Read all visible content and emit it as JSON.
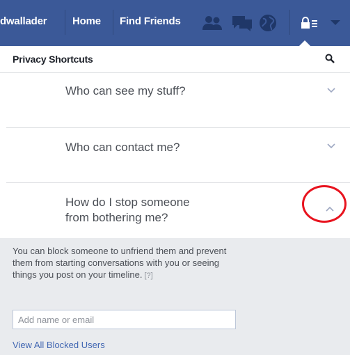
{
  "topbar": {
    "user_name": "dwallader",
    "home_label": "Home",
    "find_friends_label": "Find Friends",
    "icons": [
      "friend-requests-icon",
      "messages-icon",
      "notifications-globe-icon",
      "privacy-shortcuts-lock-icon",
      "account-menu-arrow-icon"
    ]
  },
  "panel": {
    "title": "Privacy Shortcuts",
    "search_icon": "search-icon"
  },
  "sections": [
    {
      "question": "Who can see my stuff?",
      "state": "collapsed"
    },
    {
      "question": "Who can contact me?",
      "state": "collapsed"
    },
    {
      "question_line1": "How do I stop someone",
      "question_line2": "from bothering me?",
      "state": "expanded"
    }
  ],
  "expanded": {
    "description": "You can block someone to unfriend them and prevent them from starting conversations with you or seeing things you post on your timeline.",
    "help_link": "[?]",
    "input_placeholder": "Add name or email",
    "view_blocked_link": "View All Blocked Users"
  },
  "colors": {
    "brand_blue": "#3b5998",
    "link_blue": "#4267b2",
    "annotation_red": "#e8141f"
  }
}
